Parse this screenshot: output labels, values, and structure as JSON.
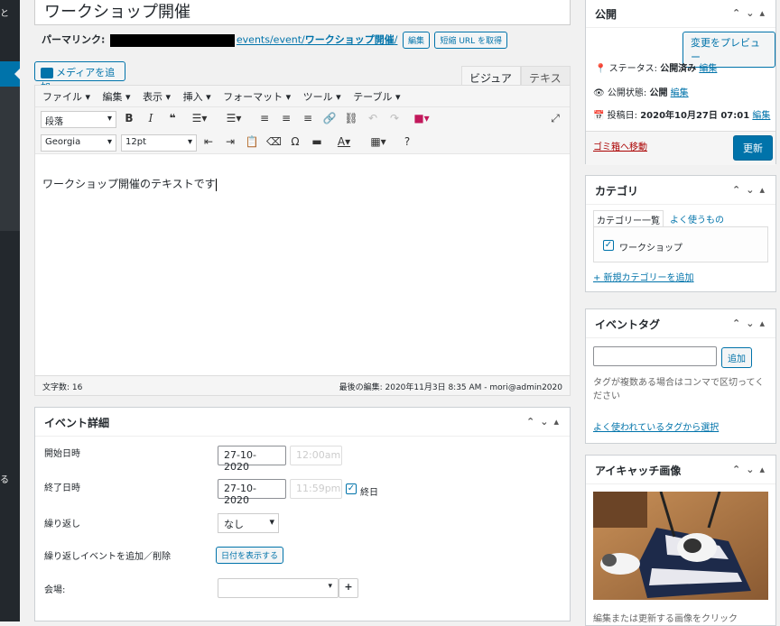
{
  "post": {
    "title": "ワークショップ開催",
    "permalink_label": "パーマリンク:",
    "permalink_url_tail": "events/event/",
    "permalink_slug": "ワークショップ開催",
    "permalink_end": "/",
    "edit_button": "編集",
    "shortlink_button": "短縮 URL を取得"
  },
  "editor": {
    "add_media": "メディアを追加",
    "tab_visual": "ビジュアル",
    "tab_text": "テキスト",
    "menu": [
      "ファイル ▾",
      "編集 ▾",
      "表示 ▾",
      "挿入 ▾",
      "フォーマット ▾",
      "ツール ▾",
      "テーブル ▾"
    ],
    "format_select": "段落",
    "font_select": "Georgia",
    "size_select": "12pt",
    "content": "ワークショップ開催のテキストです",
    "word_count": "文字数: 16",
    "last_edit": "最後の編集: 2020年11月3日 8:35 AM - mori@admin2020"
  },
  "event_details": {
    "title": "イベント詳細",
    "start_label": "開始日時",
    "start_date": "27-10-2020",
    "start_time": "12:00am",
    "end_label": "終了日時",
    "end_date": "27-10-2020",
    "end_time": "11:59pm",
    "allday_label": "終日",
    "repeat_label": "繰り返し",
    "repeat_value": "なし",
    "add_remove_label": "繰り返しイベントを追加／削除",
    "show_dates_button": "日付を表示する",
    "venue_label": "会場:"
  },
  "publish": {
    "title": "公開",
    "preview_button": "変更をプレビュー",
    "status_label": "ステータス:",
    "status_value": "公開済み",
    "visibility_label": "公開状態:",
    "visibility_value": "公開",
    "date_label": "投稿日:",
    "date_value": "2020年10月27日 07:01",
    "edit_link": "編集",
    "trash_link": "ゴミ箱へ移動",
    "update_button": "更新"
  },
  "category": {
    "title": "カテゴリ",
    "tab_all": "カテゴリー一覧",
    "tab_popular": "よく使うもの",
    "item": "ワークショップ",
    "add_link": "+ 新規カテゴリーを追加"
  },
  "tags": {
    "title": "イベントタグ",
    "add_button": "追加",
    "hint": "タグが複数ある場合はコンマで区切ってください",
    "popular_link": "よく使われているタグから選択"
  },
  "featured": {
    "title": "アイキャッチ画像",
    "caption": "編集または更新する画像をクリック"
  },
  "sidebar": {
    "glyph_top": "と",
    "glyph_bottom": "る"
  }
}
